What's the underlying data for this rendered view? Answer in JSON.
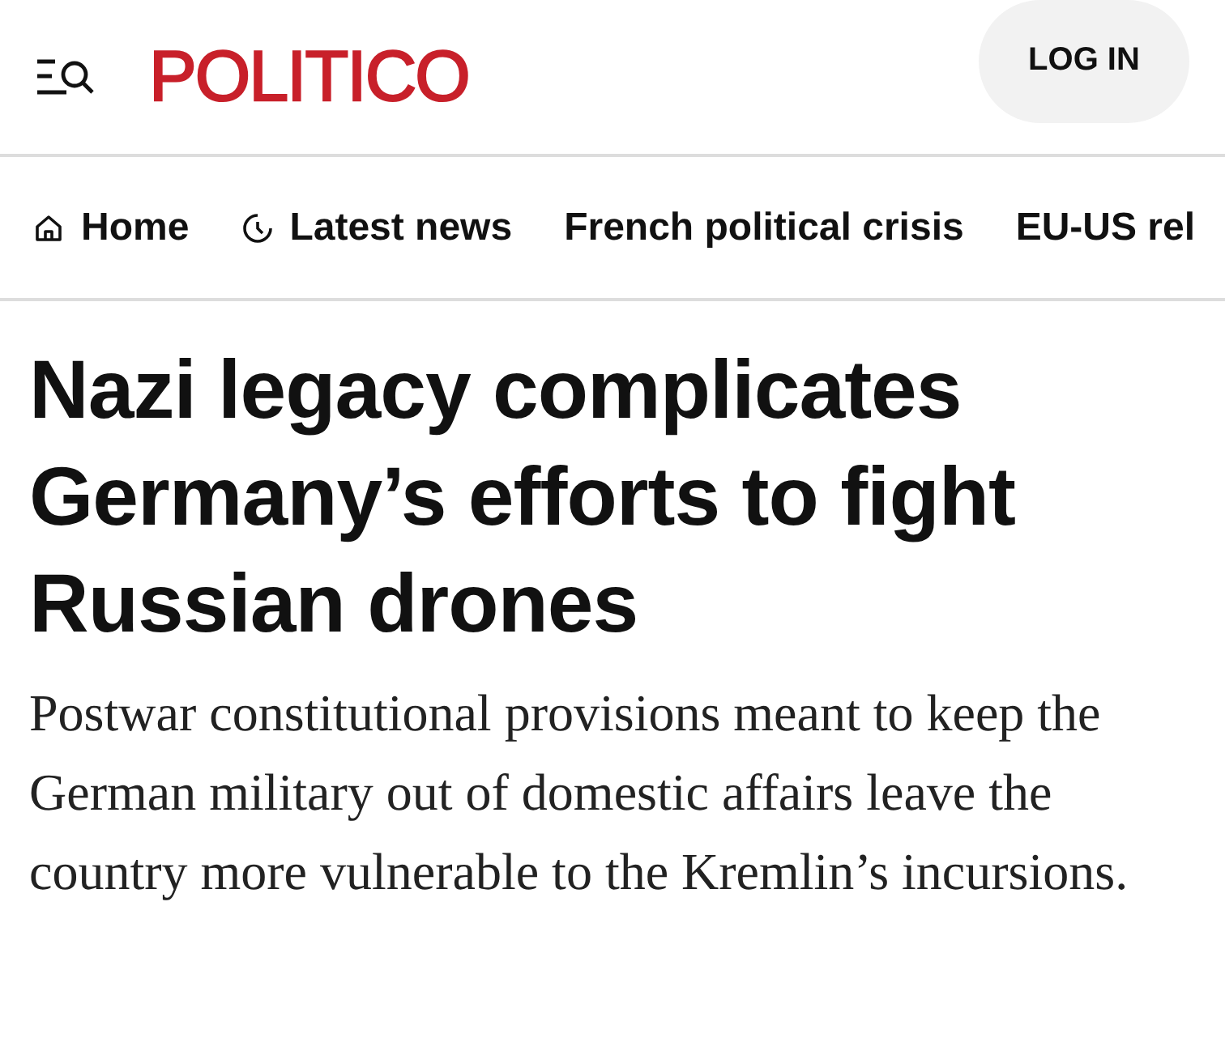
{
  "header": {
    "logo": "POLITICO",
    "login_button": "LOG IN"
  },
  "nav": [
    {
      "label": "Home",
      "kind": "home"
    },
    {
      "label": "Latest news",
      "kind": "recent"
    },
    {
      "label": "French political crisis",
      "kind": "plain"
    },
    {
      "label": "EU-US rel",
      "kind": "plain"
    }
  ],
  "article": {
    "headline": "Nazi legacy complicates Germany’s efforts to fight Russian drones",
    "summary": "Postwar constitutional provisions meant to keep the German military out of domestic affairs leave the country more vulnerable to the Kremlin’s incursions."
  }
}
